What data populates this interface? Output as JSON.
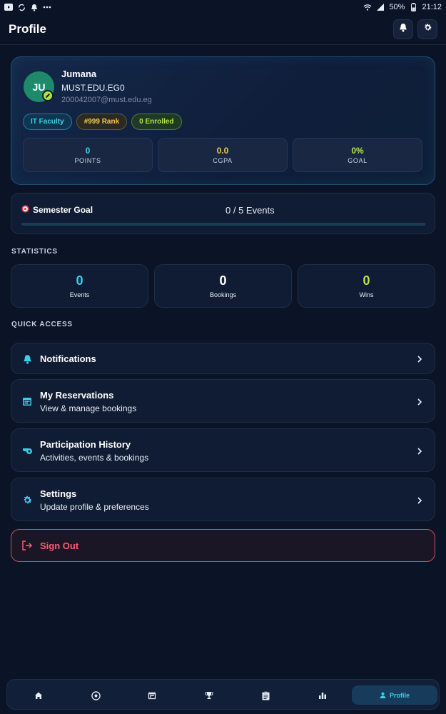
{
  "status_bar": {
    "battery": "50%",
    "time": "21:12",
    "icons": [
      "youtube-icon",
      "sync-icon",
      "bell-icon",
      "more-icon",
      "wifi-icon",
      "signal-icon",
      "battery-icon"
    ]
  },
  "header": {
    "title": "Profile",
    "buttons": [
      "notifications-bell-icon",
      "settings-gear-icon"
    ]
  },
  "profile": {
    "initials": "JU",
    "name": "Jumana",
    "org": "MUST.EDU.EG0",
    "email": "200042007@must.edu.eg",
    "chips": {
      "faculty": "IT Faculty",
      "rank": "#999 Rank",
      "enrolled": "0 Enrolled"
    },
    "stats": [
      {
        "value": "0",
        "label": "POINTS",
        "color": "#3ccfe8"
      },
      {
        "value": "0.0",
        "label": "CGPA",
        "color": "#f2c94c"
      },
      {
        "value": "0%",
        "label": "GOAL",
        "color": "#b5e34d"
      }
    ]
  },
  "semester_goal": {
    "icon": "target-icon",
    "title": "Semester Goal",
    "events": "0 / 5 Events",
    "progress": 0
  },
  "statistics": {
    "section_label": "STATISTICS",
    "items": [
      {
        "value": "0",
        "label": "Events",
        "color": "#3ccfe8"
      },
      {
        "value": "0",
        "label": "Bookings",
        "color": "#ffffff"
      },
      {
        "value": "0",
        "label": "Wins",
        "color": "#b5e34d"
      }
    ]
  },
  "quick_access": {
    "section_label": "QUICK ACCESS",
    "items": [
      {
        "title": "Notifications",
        "subtitle": "",
        "icon": "bell-icon"
      },
      {
        "title": "My Reservations",
        "subtitle": "View & manage bookings",
        "icon": "calendar-icon"
      },
      {
        "title": "Participation History",
        "subtitle": "Activities, events & bookings",
        "icon": "whistle-icon"
      },
      {
        "title": "Settings",
        "subtitle": "Update profile & preferences",
        "icon": "gear-icon"
      }
    ]
  },
  "sign_out": {
    "label": "Sign Out",
    "icon": "logout-icon"
  },
  "bottom_nav": {
    "items": [
      "home-icon",
      "ball-icon",
      "calendar-icon",
      "trophy-icon",
      "clipboard-icon",
      "bar-chart-icon"
    ],
    "active_label": "Profile"
  },
  "colors": {
    "background": "#0b1426",
    "accent": "#3ccfe8",
    "danger": "#ff5a6a"
  }
}
